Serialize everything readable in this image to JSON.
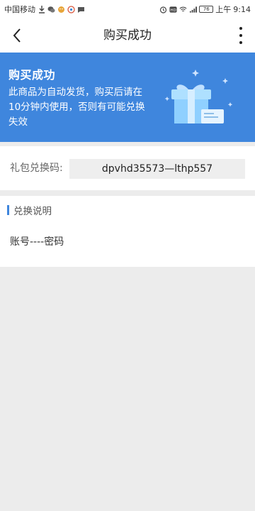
{
  "status_bar": {
    "carrier": "中国移动",
    "battery": "76",
    "period": "上午",
    "time": "9:14"
  },
  "nav": {
    "title": "购买成功"
  },
  "banner": {
    "title": "购买成功",
    "description": "此商品为自动发货，购买后请在10分钟内使用，否则有可能兑换失效",
    "bg_color": "#3f86dd"
  },
  "code": {
    "label": "礼包兑换码:",
    "value": "dpvhd35573—lthp557"
  },
  "instructions": {
    "title": "兑换说明",
    "body": "账号----密码"
  },
  "icons": {
    "back": "back-arrow-icon",
    "more": "more-vertical-icon",
    "gift": "gift-box-icon"
  }
}
